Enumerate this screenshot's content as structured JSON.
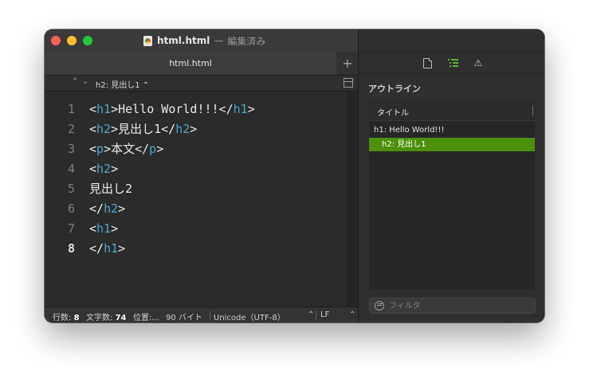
{
  "window": {
    "title_filename": "html.html",
    "title_separator": "—",
    "title_status": "編集済み"
  },
  "tabs": [
    {
      "label": "html.html"
    }
  ],
  "tab_add_label": "+",
  "navigation": {
    "breadcrumb": "h2: 見出し1 ⌃"
  },
  "editor": {
    "lines": [
      {
        "number": "1",
        "parts": [
          [
            "p",
            "<"
          ],
          [
            "t",
            "h1"
          ],
          [
            "p",
            ">Hello World!!!</"
          ],
          [
            "t",
            "h1"
          ],
          [
            "p",
            ">"
          ]
        ]
      },
      {
        "number": "2",
        "parts": [
          [
            "p",
            "<"
          ],
          [
            "t",
            "h2"
          ],
          [
            "p",
            ">見出し1</"
          ],
          [
            "t",
            "h2"
          ],
          [
            "p",
            ">"
          ]
        ]
      },
      {
        "number": "3",
        "parts": [
          [
            "p",
            "<"
          ],
          [
            "t",
            "p"
          ],
          [
            "p",
            ">本文</"
          ],
          [
            "t",
            "p"
          ],
          [
            "p",
            ">"
          ]
        ]
      },
      {
        "number": "4",
        "parts": [
          [
            "p",
            "<"
          ],
          [
            "t",
            "h2"
          ],
          [
            "p",
            ">"
          ]
        ]
      },
      {
        "number": "5",
        "parts": [
          [
            "p",
            "見出し2"
          ]
        ]
      },
      {
        "number": "6",
        "parts": [
          [
            "p",
            "</"
          ],
          [
            "t",
            "h2"
          ],
          [
            "p",
            ">"
          ]
        ]
      },
      {
        "number": "7",
        "parts": [
          [
            "p",
            "<"
          ],
          [
            "t",
            "h1"
          ],
          [
            "p",
            ">"
          ]
        ]
      },
      {
        "number": "8",
        "parts": [
          [
            "p",
            "</"
          ],
          [
            "t",
            "h1"
          ],
          [
            "p",
            ">"
          ]
        ]
      }
    ],
    "current_line": "8"
  },
  "statusbar": {
    "lines_label": "行数:",
    "lines_value": "8",
    "chars_label": "文字数:",
    "chars_value": "74",
    "position_label": "位置:...",
    "size": "90 バイト",
    "encoding": "Unicode（UTF-8）",
    "line_ending": "LF"
  },
  "inspector": {
    "section_title": "アウトライン",
    "column_header": "タイトル",
    "items": [
      {
        "label": "h1: Hello World!!!",
        "selected": false
      },
      {
        "label": "h2: 見出し1",
        "selected": true
      }
    ],
    "filter_placeholder": "フィルタ"
  },
  "colors": {
    "tag": "#4ea3c9",
    "selection": "#4e8f0b",
    "active_tab_icon": "#58b03c"
  }
}
